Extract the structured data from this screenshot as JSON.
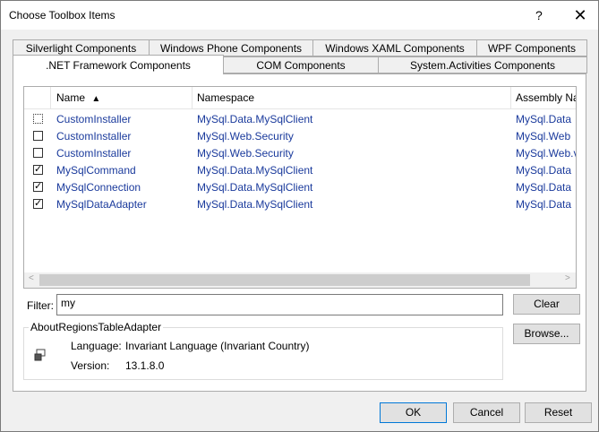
{
  "window": {
    "title": "Choose Toolbox Items",
    "help_glyph": "?",
    "close_glyph": "✕"
  },
  "tabs_row1": [
    {
      "label": "Silverlight Components"
    },
    {
      "label": "Windows Phone Components"
    },
    {
      "label": "Windows XAML Components"
    },
    {
      "label": "WPF Components"
    }
  ],
  "tabs_row2": [
    {
      "label": ".NET Framework Components",
      "active": true
    },
    {
      "label": "COM Components"
    },
    {
      "label": "System.Activities Components"
    }
  ],
  "grid": {
    "columns": {
      "name": "Name",
      "sort_glyph": "▲",
      "namespace": "Namespace",
      "assembly": "Assembly Na"
    },
    "rows": [
      {
        "checked": "",
        "name": "CustomInstaller",
        "namespace": "MySql.Data.MySqlClient",
        "assembly": "MySql.Data"
      },
      {
        "checked": "",
        "name": "CustomInstaller",
        "namespace": "MySql.Web.Security",
        "assembly": "MySql.Web"
      },
      {
        "checked": "",
        "name": "CustomInstaller",
        "namespace": "MySql.Web.Security",
        "assembly": "MySql.Web.v"
      },
      {
        "checked": "✓",
        "name": "MySqlCommand",
        "namespace": "MySql.Data.MySqlClient",
        "assembly": "MySql.Data"
      },
      {
        "checked": "✓",
        "name": "MySqlConnection",
        "namespace": "MySql.Data.MySqlClient",
        "assembly": "MySql.Data"
      },
      {
        "checked": "✓",
        "name": "MySqlDataAdapter",
        "namespace": "MySql.Data.MySqlClient",
        "assembly": "MySql.Data"
      }
    ],
    "scroll_left": "<",
    "scroll_right": ">"
  },
  "filter": {
    "label": "Filter:",
    "value": "my"
  },
  "buttons": {
    "clear": "Clear",
    "browse": "Browse...",
    "ok": "OK",
    "cancel": "Cancel",
    "reset": "Reset"
  },
  "details": {
    "title": "AboutRegionsTableAdapter",
    "icon": "component-icon",
    "language_label": "Language:",
    "language_value": "Invariant Language (Invariant Country)",
    "version_label": "Version:",
    "version_value": "13.1.8.0"
  }
}
